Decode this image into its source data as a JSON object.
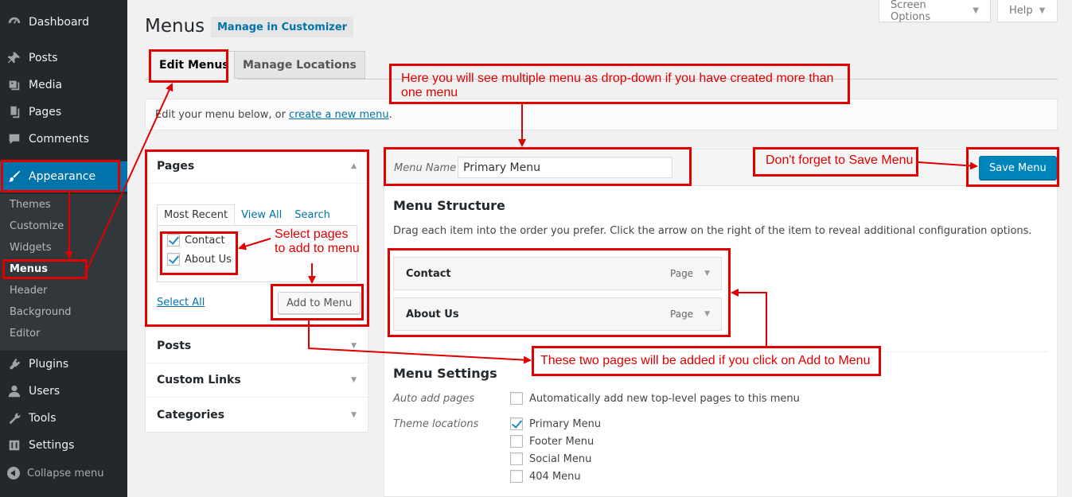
{
  "sidebar": {
    "items": [
      {
        "label": "Dashboard",
        "icon": "dashboard-icon"
      },
      {
        "label": "Posts",
        "icon": "pin-icon"
      },
      {
        "label": "Media",
        "icon": "media-icon"
      },
      {
        "label": "Pages",
        "icon": "pages-icon"
      },
      {
        "label": "Comments",
        "icon": "comment-icon"
      },
      {
        "label": "Appearance",
        "icon": "brush-icon"
      },
      {
        "label": "Plugins",
        "icon": "plugin-icon"
      },
      {
        "label": "Users",
        "icon": "user-icon"
      },
      {
        "label": "Tools",
        "icon": "wrench-icon"
      },
      {
        "label": "Settings",
        "icon": "settings-icon"
      }
    ],
    "submenu": [
      "Themes",
      "Customize",
      "Widgets",
      "Menus",
      "Header",
      "Background",
      "Editor"
    ],
    "collapse_label": "Collapse menu"
  },
  "header": {
    "title": "Menus",
    "manage_customizer": "Manage in Customizer",
    "screen_options": "Screen Options",
    "help": "Help"
  },
  "tabs": {
    "edit": "Edit Menus",
    "locations": "Manage Locations"
  },
  "manage": {
    "text": "Edit your menu below, or",
    "link": "create a new menu",
    "end": "."
  },
  "left": {
    "pages_title": "Pages",
    "tabs": [
      "Most Recent",
      "View All",
      "Search"
    ],
    "checkboxes": [
      {
        "label": "Contact",
        "checked": true
      },
      {
        "label": "About Us",
        "checked": true
      }
    ],
    "select_all": "Select All",
    "add_button": "Add to Menu",
    "sections": [
      "Posts",
      "Custom Links",
      "Categories"
    ]
  },
  "right": {
    "menu_name_label": "Menu Name",
    "menu_name_value": "Primary Menu",
    "save_button": "Save Menu",
    "structure_title": "Menu Structure",
    "structure_desc": "Drag each item into the order you prefer. Click the arrow on the right of the item to reveal additional configuration options.",
    "items": [
      {
        "title": "Contact",
        "type": "Page"
      },
      {
        "title": "About Us",
        "type": "Page"
      }
    ],
    "settings_title": "Menu Settings",
    "auto_add_label": "Auto add pages",
    "auto_add_text": "Automatically add new top-level pages to this menu",
    "theme_locations_label": "Theme locations",
    "locations": [
      {
        "label": "Primary Menu",
        "checked": true
      },
      {
        "label": "Footer Menu",
        "checked": false
      },
      {
        "label": "Social Menu",
        "checked": false
      },
      {
        "label": "404 Menu",
        "checked": false
      }
    ]
  },
  "annotations": {
    "dropdown_note_1": "Here you will see multiple menu as drop-down if you have created more than",
    "dropdown_note_2": "one menu",
    "save_note": "Don't forget to Save Menu",
    "select_note_1": "Select pages",
    "select_note_2": "to add to menu",
    "added_note": "These two pages will be added if you click on Add to Menu"
  },
  "colors": {
    "sidebar_bg": "#23282d",
    "accent": "#0073aa",
    "annotation": "#e00000"
  }
}
